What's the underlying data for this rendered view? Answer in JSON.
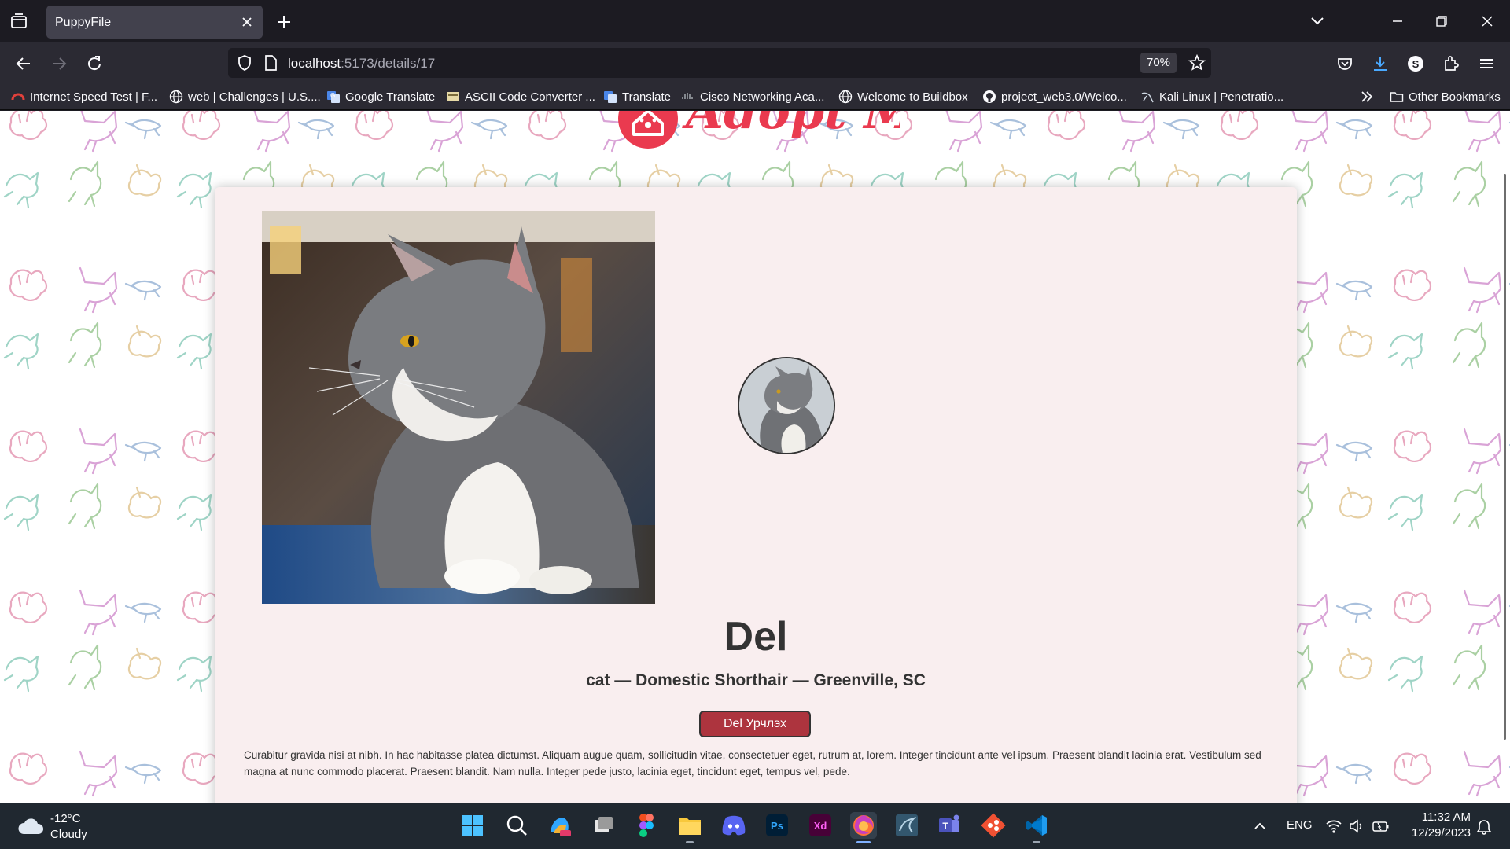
{
  "browser": {
    "tab_title": "PuppyFile",
    "url_host": "localhost",
    "url_path": ":5173/details/17",
    "zoom": "70%",
    "bookmarks": [
      {
        "label": "Internet Speed Test | F...",
        "icon": "speedometer-icon"
      },
      {
        "label": "web | Challenges | U.S....",
        "icon": "globe-icon"
      },
      {
        "label": "Google Translate",
        "icon": "translate-icon"
      },
      {
        "label": "ASCII Code Converter ...",
        "icon": "converter-icon"
      },
      {
        "label": "Translate",
        "icon": "translate-icon"
      },
      {
        "label": "Cisco Networking Aca...",
        "icon": "cisco-icon"
      },
      {
        "label": "Welcome to Buildbox",
        "icon": "globe-icon"
      },
      {
        "label": "project_web3.0/Welco...",
        "icon": "github-icon"
      },
      {
        "label": "Kali Linux | Penetratio...",
        "icon": "kali-icon"
      }
    ],
    "other_bookmarks": "Other Bookmarks"
  },
  "page": {
    "logo_text": "Adopt Me!",
    "pet": {
      "name": "Del",
      "subtitle": "cat — Domestic Shorthair — Greenville, SC",
      "adopt_button": "Del Урчлэх",
      "description": "Curabitur gravida nisi at nibh. In hac habitasse platea dictumst. Aliquam augue quam, sollicitudin vitae, consectetuer eget, rutrum at, lorem. Integer tincidunt ante vel ipsum. Praesent blandit lacinia erat. Vestibulum sed magna at nunc commodo placerat. Praesent blandit. Nam nulla. Integer pede justo, lacinia eget, tincidunt eget, tempus vel, pede."
    }
  },
  "taskbar": {
    "weather_temp": "-12°C",
    "weather_condition": "Cloudy",
    "language": "ENG",
    "time": "11:32 AM",
    "date": "12/29/2023",
    "apps": [
      "windows-start",
      "search",
      "copilot",
      "task-view",
      "figma",
      "file-explorer",
      "discord",
      "photoshop",
      "adobe-xd",
      "firefox",
      "mysql-workbench",
      "teams",
      "git",
      "vscode"
    ]
  },
  "colors": {
    "accent_red": "#ad343e",
    "card_bg": "#f9eeef",
    "text": "#333333"
  }
}
